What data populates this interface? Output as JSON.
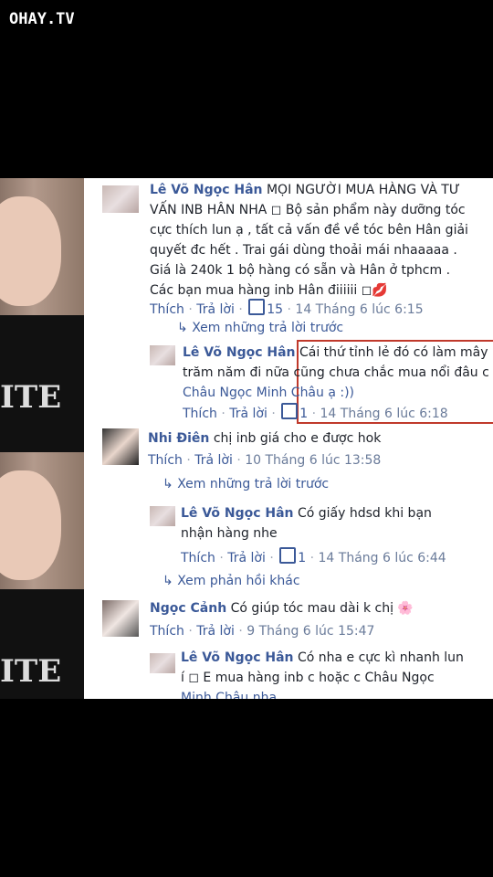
{
  "watermark": "OHAY.TV",
  "comments": [
    {
      "author": "Lê Võ Ngọc Hân",
      "text_lines": [
        "MỌI NGƯỜI MUA HÀNG VÀ TƯ",
        "VẤN INB HÂN NHA ◻ Bộ sản phẩm này dưỡng tóc",
        "cực thích lun ạ , tất cả vấn đề về tóc bên Hân giải",
        "quyết đc hết . Trai gái dùng thoải mái nhaaaaa .",
        "Giá là 240k 1 bộ hàng có sẵn và Hân ở tphcm .",
        "Các bạn mua hàng inb Hân điiiiii ◻💋"
      ],
      "like": "Thích",
      "reply": "Trả lời",
      "likes": "15",
      "time": "14 Tháng 6 lúc 6:15"
    },
    {
      "more": "Xem những trả lời trước"
    },
    {
      "author": "Lê Võ Ngọc Hân",
      "text_lines": [
        "Cái thứ tỉnh lẻ đó có làm mây",
        "trăm năm đi nữa cũng chưa chắc mua nổi đâu c",
        "Châu Ngọc Minh Châu ạ :))"
      ],
      "like": "Thích",
      "reply": "Trả lời",
      "likes": "1",
      "time": "14 Tháng 6 lúc 6:18"
    },
    {
      "author": "Nhi Điên",
      "text_lines": [
        "chị inb giá cho e được hok"
      ],
      "like": "Thích",
      "reply": "Trả lời",
      "time": "10 Tháng 6 lúc 13:58"
    },
    {
      "more": "Xem những trả lời trước"
    },
    {
      "author": "Lê Võ Ngọc Hân",
      "text_lines": [
        "Có giấy hdsd khi bạn",
        "nhận hàng nhe"
      ],
      "like": "Thích",
      "reply": "Trả lời",
      "likes": "1",
      "time": "14 Tháng 6 lúc 6:44"
    },
    {
      "more": "Xem phản hồi khác"
    },
    {
      "author": "Ngọc Cảnh",
      "text_lines": [
        "Có giúp tóc mau dài k chị 🌸"
      ],
      "like": "Thích",
      "reply": "Trả lời",
      "time": "9 Tháng 6 lúc 15:47"
    },
    {
      "author": "Lê Võ Ngọc Hân",
      "text_lines": [
        "Có nha e cực kì nhanh lun",
        "í ◻ E mua hàng inb c hoặc c Châu Ngọc",
        "Minh Châu nha"
      ]
    }
  ],
  "photo_text": "ITE",
  "highlight_color": "#c0392b",
  "link_color": "#3b5998"
}
